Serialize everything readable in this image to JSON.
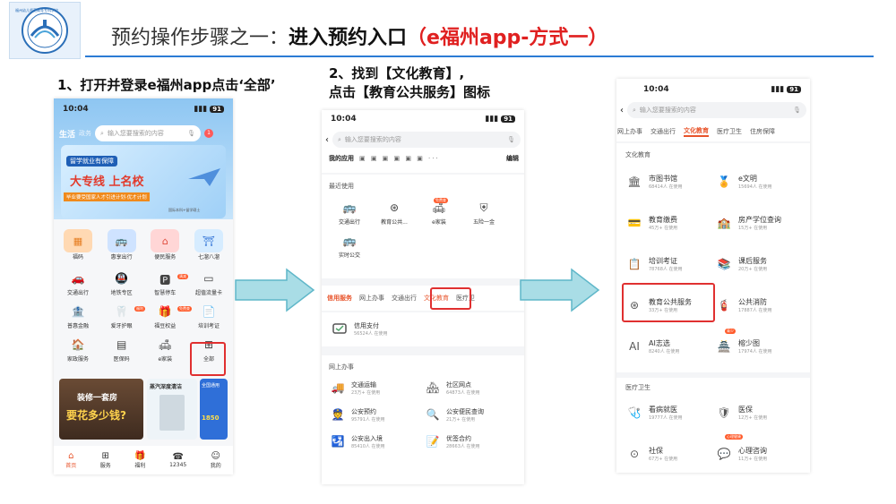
{
  "title": {
    "part1": "预约操作步骤之一：",
    "part2": "进入预约入口",
    "part3": "（e福州app-方式一）"
  },
  "logo": {
    "text": "福州幼儿师范高等专科学校"
  },
  "step1": "1、打开并登录e福州app点击‘全部’",
  "step2_line1": "2、找到【文化教育】,",
  "step2_line2": "点击【教育公共服务】图标",
  "phone1": {
    "time": "10:04",
    "battery": "91",
    "tab_life": "生活",
    "tab_affairs": "政务",
    "search_placeholder": "输入您要搜索的内容",
    "notif_count": "1",
    "banner_tag": "留学就业有保障",
    "banner_main": "大专线  上名校",
    "banner_sub": "毕业要受国家人才引进计划·优才计划",
    "banner_note": "国际本科+留学硕士",
    "top_items": [
      "福码",
      "惠享出行",
      "便民服务",
      "七溜八溜"
    ],
    "grid": [
      [
        "交通出行",
        "地铁专区",
        "智慧停车",
        "超值流量卡"
      ],
      [
        "普惠金融",
        "爱牙护眼",
        "福豆权益",
        "培训考证"
      ],
      [
        "家政服务",
        "医保码",
        "e家装",
        "全部"
      ]
    ],
    "badges": {
      "b1": "满减",
      "b2": "福利",
      "b3": "免费查"
    },
    "promo1_title": "装修一套房",
    "promo1_sub": "要花多少钱?",
    "promo2_title": "蒸汽深度清洁",
    "promo3_title": "全国通用",
    "promo3_num": "1850",
    "bottom_nav": [
      "首页",
      "服务",
      "福利",
      "12345",
      "我的"
    ]
  },
  "phone2": {
    "time": "10:04",
    "battery": "91",
    "search_placeholder": "输入您要搜索的内容",
    "myapps_label": "我的应用",
    "edit_label": "编辑",
    "recent_label": "最近使用",
    "recent_items": [
      "交通出行",
      "教育公共...",
      "e家装",
      "五险一金",
      "实时公交"
    ],
    "recent_badge": "免费查",
    "tabs": [
      "信用服务",
      "网上办事",
      "交通出行",
      "文化教育",
      "医疗卫"
    ],
    "credit_item": {
      "name": "信用支付",
      "count": "56524人 在使用"
    },
    "online_label": "网上办事",
    "online_items": [
      {
        "name": "交通运输",
        "count": "23万+ 在使用"
      },
      {
        "name": "社区网点",
        "count": "64873人 在使用"
      },
      {
        "name": "公安预约",
        "count": "95791人 在使用"
      },
      {
        "name": "公安便民查询",
        "count": "21万+ 在使用"
      },
      {
        "name": "公安出入境",
        "count": "85410人 在使用"
      },
      {
        "name": "优签合约",
        "count": "28663人 在使用"
      }
    ]
  },
  "phone3": {
    "time": "10:04",
    "battery": "91",
    "search_placeholder": "输入您要搜索的内容",
    "tabs": [
      "网上办事",
      "交通出行",
      "文化教育",
      "医疗卫生",
      "住房保障"
    ],
    "culture_label": "文化教育",
    "culture_items": [
      {
        "name": "市图书馆",
        "count": "68414人 在使用"
      },
      {
        "name": "e文明",
        "count": "15694人 在使用"
      },
      {
        "name": "教育缴费",
        "count": "45万+ 在使用"
      },
      {
        "name": "房产学位查询",
        "count": "15万+ 在使用"
      },
      {
        "name": "培训考证",
        "count": "78768人 在使用"
      },
      {
        "name": "课后服务",
        "count": "20万+ 在使用"
      },
      {
        "name": "教育公共服务",
        "count": "33万+ 在使用"
      },
      {
        "name": "公共消防",
        "count": "17887人 在使用"
      },
      {
        "name": "AI志选",
        "count": "8240人 在使用"
      },
      {
        "name": "榕少图",
        "count": "17974人 在使用"
      }
    ],
    "culture_badge": "青少",
    "medical_label": "医疗卫生",
    "medical_items": [
      {
        "name": "看病就医",
        "count": "19777人 在使用"
      },
      {
        "name": "医保",
        "count": "12万+ 在使用"
      },
      {
        "name": "社保",
        "count": "67万+ 在使用"
      },
      {
        "name": "心理咨询",
        "count": "11万+ 在使用"
      }
    ],
    "medical_badge": "心理健康"
  },
  "colors": {
    "accent_red": "#e02020",
    "accent_blue": "#2b7bd4",
    "arrow_fill": "#a9dde6",
    "arrow_stroke": "#5fb7c9"
  }
}
